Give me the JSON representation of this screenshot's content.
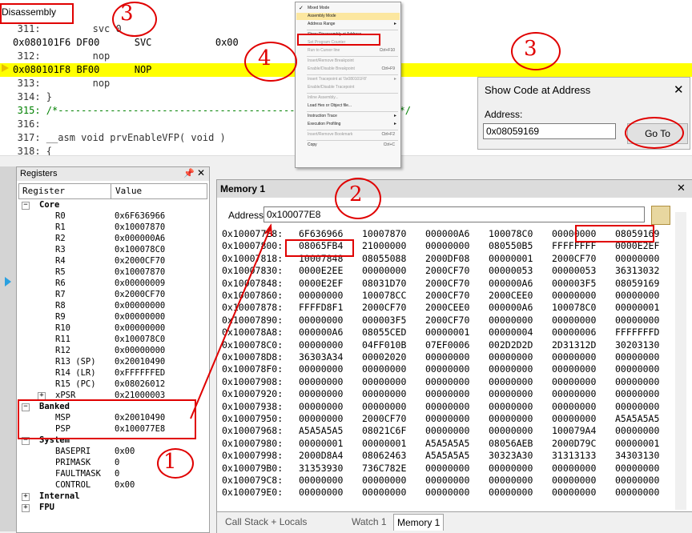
{
  "disassembly": {
    "title": "Disassembly",
    "lines": [
      {
        "text": "   311:         svc 0",
        "style": "source"
      },
      {
        "text": "0x080101F6 DF00      SVC           0x00",
        "style": "asm"
      },
      {
        "text": "   312:         nop",
        "style": "source"
      },
      {
        "text": "0x080101F8 BF00      NOP",
        "style": "asm-current"
      },
      {
        "text": "   313:         nop",
        "style": "source"
      },
      {
        "text": "   314: }",
        "style": "source"
      },
      {
        "text": "   315: /*-----------------------------------------------------------*/",
        "style": "comment"
      },
      {
        "text": "   316: ",
        "style": "source"
      },
      {
        "text": "   317: __asm void prvEnableVFP( void )",
        "style": "source"
      },
      {
        "text": "   318: {",
        "style": "source"
      }
    ]
  },
  "context_menu": {
    "items": [
      {
        "label": "Mixed Mode",
        "checked": true
      },
      {
        "label": "Assembly Mode",
        "hover": true
      },
      {
        "label": "Address Range",
        "submenu": true
      },
      {
        "label": "Show Disassembly at Address...",
        "boxed": true
      },
      {
        "label": "Set Program Counter",
        "disabled": true
      },
      {
        "label": "Run to Cursor line",
        "shortcut": "Ctrl+F10",
        "disabled": true
      },
      {
        "label": "Insert/Remove Breakpoint",
        "disabled": true
      },
      {
        "label": "Enable/Disable Breakpoint",
        "shortcut": "Ctrl+F9",
        "disabled": true
      },
      {
        "label": "Insert Tracepoint at '0x080101F8'",
        "submenu": true,
        "disabled": true
      },
      {
        "label": "Enable/Disable Tracepoint",
        "disabled": true
      },
      {
        "label": "Inline Assembly...",
        "disabled": true
      },
      {
        "label": "Load Hex or Object file..."
      },
      {
        "label": "Instruction Trace",
        "submenu": true
      },
      {
        "label": "Execution Profiling",
        "submenu": true
      },
      {
        "label": "Insert/Remove Bookmark",
        "shortcut": "Ctrl+F2",
        "disabled": true
      },
      {
        "label": "Copy",
        "shortcut": "Ctrl+C"
      }
    ]
  },
  "dialog": {
    "title": "Show Code at Address",
    "close": "✕",
    "address_label": "Address:",
    "address_value": "0x08059169",
    "go_button": "Go To"
  },
  "registers": {
    "title": "Registers",
    "col_register": "Register",
    "col_value": "Value",
    "rows": [
      {
        "name": "Core",
        "value": "",
        "indent": 0,
        "group": true,
        "exp": "−"
      },
      {
        "name": "R0",
        "value": "0x6F636966",
        "indent": 2
      },
      {
        "name": "R1",
        "value": "0x10007870",
        "indent": 2
      },
      {
        "name": "R2",
        "value": "0x000000A6",
        "indent": 2
      },
      {
        "name": "R3",
        "value": "0x100078C0",
        "indent": 2
      },
      {
        "name": "R4",
        "value": "0x2000CF70",
        "indent": 2
      },
      {
        "name": "R5",
        "value": "0x10007870",
        "indent": 2
      },
      {
        "name": "R6",
        "value": "0x00000009",
        "indent": 2
      },
      {
        "name": "R7",
        "value": "0x2000CF70",
        "indent": 2
      },
      {
        "name": "R8",
        "value": "0x00000000",
        "indent": 2
      },
      {
        "name": "R9",
        "value": "0x00000000",
        "indent": 2
      },
      {
        "name": "R10",
        "value": "0x00000000",
        "indent": 2
      },
      {
        "name": "R11",
        "value": "0x100078C0",
        "indent": 2
      },
      {
        "name": "R12",
        "value": "0x00000000",
        "indent": 2
      },
      {
        "name": "R13 (SP)",
        "value": "0x20010490",
        "indent": 2
      },
      {
        "name": "R14 (LR)",
        "value": "0xFFFFFFED",
        "indent": 2
      },
      {
        "name": "R15 (PC)",
        "value": "0x08026012",
        "indent": 2
      },
      {
        "name": "xPSR",
        "value": "0x21000003",
        "indent": 2,
        "exp": "+"
      },
      {
        "name": "Banked",
        "value": "",
        "indent": 0,
        "group": true,
        "exp": "−"
      },
      {
        "name": "MSP",
        "value": "0x20010490",
        "indent": 2
      },
      {
        "name": "PSP",
        "value": "0x100077E8",
        "indent": 2
      },
      {
        "name": "System",
        "value": "",
        "indent": 0,
        "group": true,
        "exp": "−"
      },
      {
        "name": "BASEPRI",
        "value": "0x00",
        "indent": 2
      },
      {
        "name": "PRIMASK",
        "value": "0",
        "indent": 2
      },
      {
        "name": "FAULTMASK",
        "value": "0",
        "indent": 2
      },
      {
        "name": "CONTROL",
        "value": "0x00",
        "indent": 2
      },
      {
        "name": "Internal",
        "value": "",
        "indent": 0,
        "group": true,
        "exp": "+"
      },
      {
        "name": "FPU",
        "value": "",
        "indent": 0,
        "group": true,
        "exp": "+"
      }
    ]
  },
  "memory": {
    "title": "Memory 1",
    "address_label": "Address:",
    "address_value": "0x100077E8",
    "rows": [
      {
        "addr": "0x100077E8:",
        "words": [
          "6F636966",
          "10007870",
          "000000A6",
          "100078C0",
          "00000000",
          "08059169"
        ]
      },
      {
        "addr": "0x10007800:",
        "words": [
          "08065FB4",
          "21000000",
          "00000000",
          "080550B5",
          "FFFFFFFF",
          "0000E2EF"
        ]
      },
      {
        "addr": "0x10007818:",
        "words": [
          "10007848",
          "08055088",
          "2000DF08",
          "00000001",
          "2000CF70",
          "00000000"
        ]
      },
      {
        "addr": "0x10007830:",
        "words": [
          "0000E2EE",
          "00000000",
          "2000CF70",
          "00000053",
          "00000053",
          "36313032"
        ]
      },
      {
        "addr": "0x10007848:",
        "words": [
          "0000E2EF",
          "08031D70",
          "2000CF70",
          "000000A6",
          "000003F5",
          "08059169"
        ]
      },
      {
        "addr": "0x10007860:",
        "words": [
          "00000000",
          "100078CC",
          "2000CF70",
          "2000CEE0",
          "00000000",
          "00000000"
        ]
      },
      {
        "addr": "0x10007878:",
        "words": [
          "FFFFD8F1",
          "2000CF70",
          "2000CEE0",
          "000000A6",
          "100078C0",
          "00000001"
        ]
      },
      {
        "addr": "0x10007890:",
        "words": [
          "00000000",
          "000003F5",
          "2000CF70",
          "00000000",
          "00000000",
          "00000000"
        ]
      },
      {
        "addr": "0x100078A8:",
        "words": [
          "000000A6",
          "08055CED",
          "00000001",
          "00000004",
          "00000006",
          "FFFFFFFD"
        ]
      },
      {
        "addr": "0x100078C0:",
        "words": [
          "00000000",
          "04FF010B",
          "07EF0006",
          "002D2D2D",
          "2D31312D",
          "30203130"
        ]
      },
      {
        "addr": "0x100078D8:",
        "words": [
          "36303A34",
          "00002020",
          "00000000",
          "00000000",
          "00000000",
          "00000000"
        ]
      },
      {
        "addr": "0x100078F0:",
        "words": [
          "00000000",
          "00000000",
          "00000000",
          "00000000",
          "00000000",
          "00000000"
        ]
      },
      {
        "addr": "0x10007908:",
        "words": [
          "00000000",
          "00000000",
          "00000000",
          "00000000",
          "00000000",
          "00000000"
        ]
      },
      {
        "addr": "0x10007920:",
        "words": [
          "00000000",
          "00000000",
          "00000000",
          "00000000",
          "00000000",
          "00000000"
        ]
      },
      {
        "addr": "0x10007938:",
        "words": [
          "00000000",
          "00000000",
          "00000000",
          "00000000",
          "00000000",
          "00000000"
        ]
      },
      {
        "addr": "0x10007950:",
        "words": [
          "00000000",
          "2000CF70",
          "00000000",
          "00000000",
          "00000000",
          "A5A5A5A5"
        ]
      },
      {
        "addr": "0x10007968:",
        "words": [
          "A5A5A5A5",
          "08021C6F",
          "00000000",
          "00000000",
          "100079A4",
          "00000000"
        ]
      },
      {
        "addr": "0x10007980:",
        "words": [
          "00000001",
          "00000001",
          "A5A5A5A5",
          "08056AEB",
          "2000D79C",
          "00000001"
        ]
      },
      {
        "addr": "0x10007998:",
        "words": [
          "2000D8A4",
          "08062463",
          "A5A5A5A5",
          "30323A30",
          "31313133",
          "34303130"
        ]
      },
      {
        "addr": "0x100079B0:",
        "words": [
          "31353930",
          "736C782E",
          "00000000",
          "00000000",
          "00000000",
          "00000000"
        ]
      },
      {
        "addr": "0x100079C8:",
        "words": [
          "00000000",
          "00000000",
          "00000000",
          "00000000",
          "00000000",
          "00000000"
        ]
      },
      {
        "addr": "0x100079E0:",
        "words": [
          "00000000",
          "00000000",
          "00000000",
          "00000000",
          "00000000",
          "00000000"
        ]
      }
    ],
    "tabs": [
      {
        "label": "Call Stack + Locals",
        "active": false
      },
      {
        "label": "Watch 1",
        "active": false
      },
      {
        "label": "Memory 1",
        "active": true
      }
    ]
  },
  "annotations": [
    "3",
    "4",
    "3",
    "2",
    "1"
  ],
  "colors": {
    "highlight": "#ffff00",
    "annotation": "#e00000",
    "source_gray": "#808080"
  }
}
